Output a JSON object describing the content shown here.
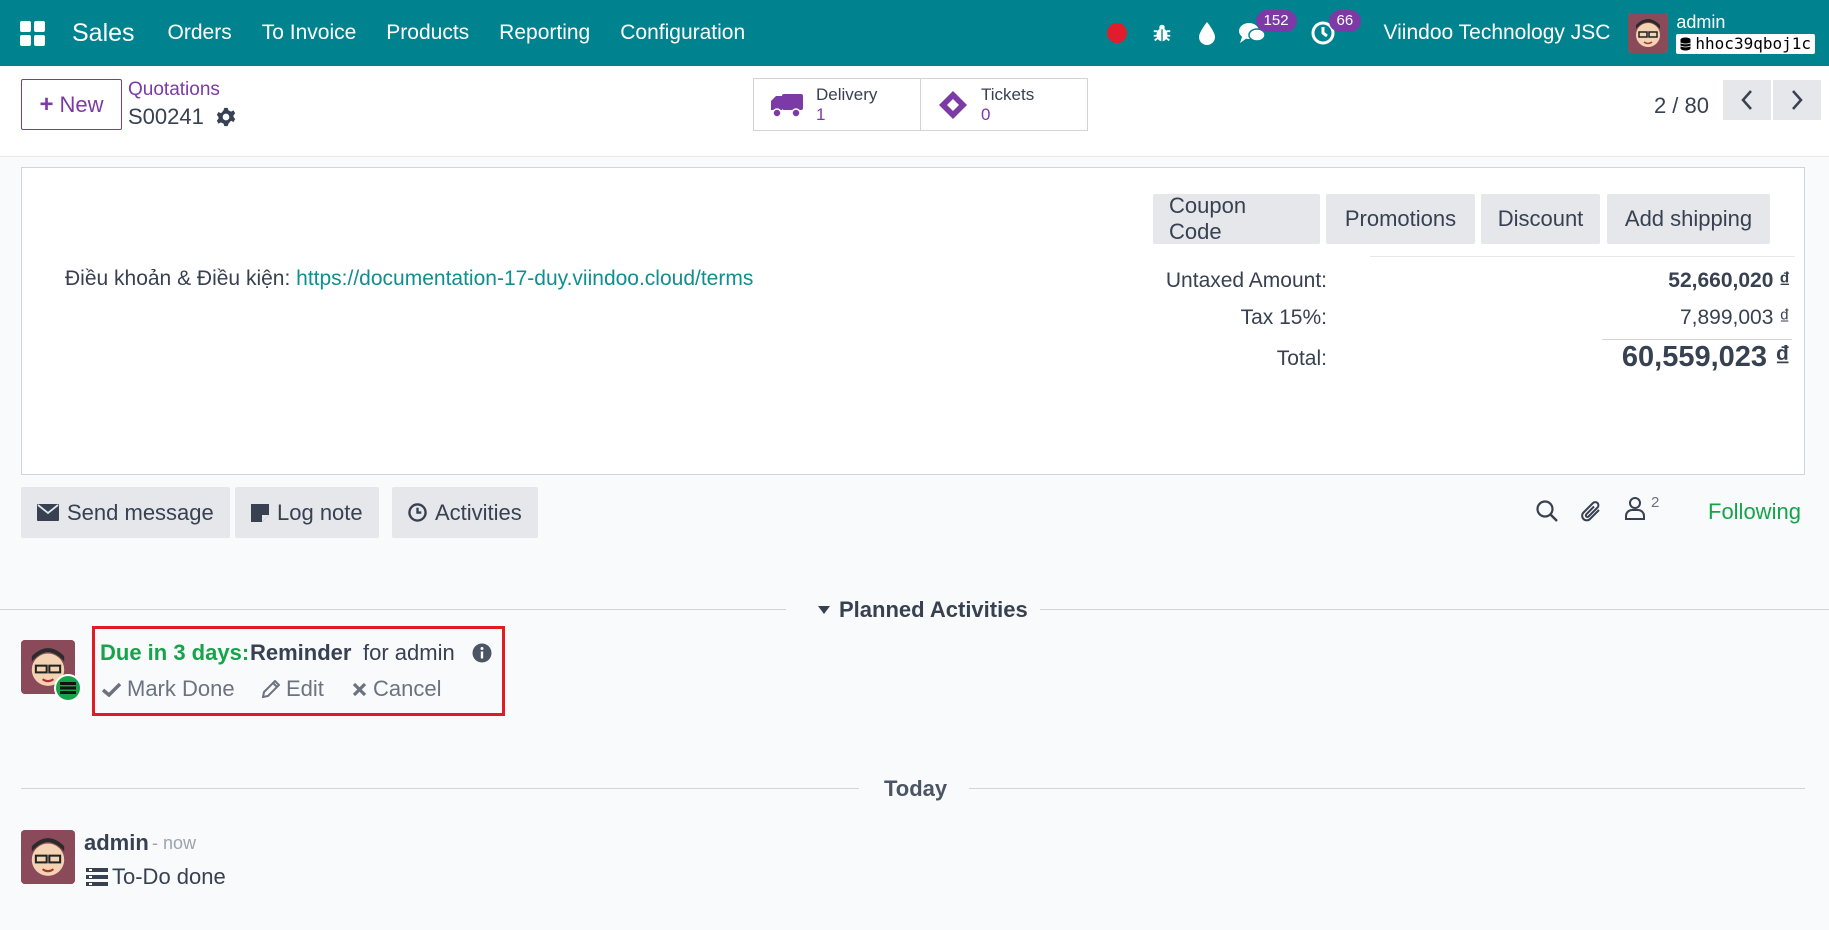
{
  "navbar": {
    "app_name": "Sales",
    "menu": [
      "Orders",
      "To Invoice",
      "Products",
      "Reporting",
      "Configuration"
    ],
    "messages_count": "152",
    "activities_count": "66",
    "company": "Viindoo Technology JSC",
    "user": "admin",
    "database": "hhoc39qboj1c"
  },
  "control": {
    "new_label": "New",
    "breadcrumb_parent": "Quotations",
    "breadcrumb_current": "S00241",
    "smart_buttons": [
      {
        "label": "Delivery",
        "value": "1"
      },
      {
        "label": "Tickets",
        "value": "0"
      }
    ],
    "pager": "2 / 80"
  },
  "sheet": {
    "buttons": [
      "Coupon Code",
      "Promotions",
      "Discount",
      "Add shipping"
    ],
    "terms_label": "Điều khoản & Điều kiện:",
    "terms_link": "https://documentation-17-duy.viindoo.cloud/terms",
    "untaxed_label": "Untaxed Amount:",
    "untaxed_value": "52,660,020 ₫",
    "tax_label": "Tax 15%:",
    "tax_value": "7,899,003 ₫",
    "total_label": "Total:",
    "total_value": "60,559,023 ₫"
  },
  "chatter": {
    "send_message": "Send message",
    "log_note": "Log note",
    "activities": "Activities",
    "followers_count": "2",
    "following": "Following"
  },
  "planned": {
    "title": "Planned Activities",
    "due": "Due in 3 days:",
    "type": "Reminder",
    "for": "for admin",
    "mark_done": "Mark Done",
    "edit": "Edit",
    "cancel": "Cancel"
  },
  "today": {
    "title": "Today",
    "author": "admin",
    "time": "- now",
    "body": "To-Do done"
  },
  "colors": {
    "brand": "#00838f",
    "accent": "#7c3aa6",
    "success": "#16a34a",
    "highlight": "#e01b24"
  }
}
